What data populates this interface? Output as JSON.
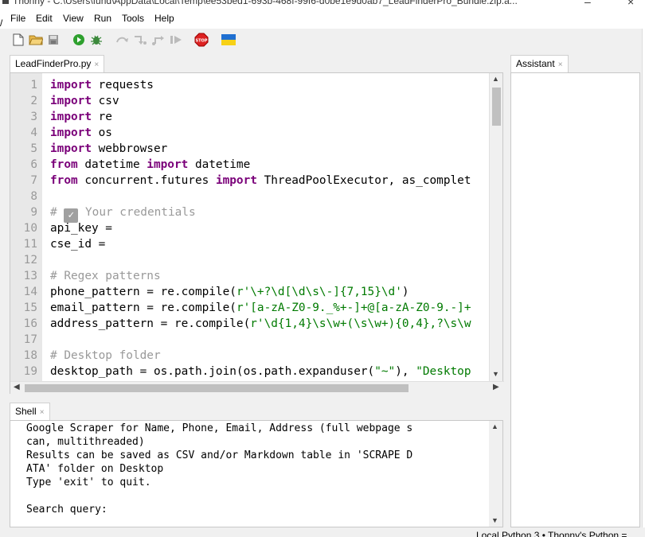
{
  "window": {
    "app_name": "Thonny",
    "title_path": "C:\\Users\\fund\\AppData\\Local\\Temp\\ee53bed1-693b-468f-99f6-d0be1e9d0ab7_LeadFinderPro_Bundle.zip.a..."
  },
  "menu": {
    "items": [
      {
        "label": "File"
      },
      {
        "label": "Edit"
      },
      {
        "label": "View"
      },
      {
        "label": "Run"
      },
      {
        "label": "Tools"
      },
      {
        "label": "Help"
      }
    ]
  },
  "toolbar": {
    "icons": [
      "new-file-icon",
      "open-folder-icon",
      "save-icon",
      "run-icon",
      "debug-bug-icon",
      "step-over-icon",
      "step-into-icon",
      "step-out-icon",
      "resume-icon",
      "stop-icon",
      "ukraine-flag-icon"
    ]
  },
  "editor": {
    "tab_label": "LeadFinderPro.py",
    "line_numbers": [
      "1",
      "2",
      "3",
      "4",
      "5",
      "6",
      "7",
      "8",
      "9",
      "10",
      "11",
      "12",
      "13",
      "14",
      "15",
      "16",
      "17",
      "18",
      "19"
    ]
  },
  "code": {
    "l1_kw": "import",
    "l1_rest": " requests",
    "l2_kw": "import",
    "l2_rest": " csv",
    "l3_kw": "import",
    "l3_rest": " re",
    "l4_kw": "import",
    "l4_rest": " os",
    "l5_kw": "import",
    "l5_rest": " webbrowser",
    "l6_kw1": "from",
    "l6_mid": " datetime ",
    "l6_kw2": "import",
    "l6_rest": " datetime",
    "l7_kw1": "from",
    "l7_mid": " concurrent.futures ",
    "l7_kw2": "import",
    "l7_rest": " ThreadPoolExecutor, as_complet",
    "l9_pre": "# ",
    "l9_check": "✓",
    "l9_post": " Your credentials",
    "l10": "api_key = ",
    "l11": "cse_id = ",
    "l13": "# Regex patterns",
    "l14_pre": "phone_pattern = re.compile(",
    "l14_str": "r'\\+?\\d[\\d\\s\\-]{7,15}\\d'",
    "l14_post": ")",
    "l15_pre": "email_pattern = re.compile(",
    "l15_str": "r'[a-zA-Z0-9._%+-]+@[a-zA-Z0-9.-]+",
    "l16_pre": "address_pattern = re.compile(",
    "l16_str": "r'\\d{1,4}\\s\\w+(\\s\\w+){0,4},?\\s\\w",
    "l18": "# Desktop folder",
    "l19_pre": "desktop_path = os.path.join(os.path.expanduser(",
    "l19_str1": "\"~\"",
    "l19_mid": "), ",
    "l19_str2": "\"Desktop"
  },
  "shell": {
    "tab_label": "Shell",
    "output": "Google Scraper for Name, Phone, Email, Address (full webpage s\ncan, multithreaded)\nResults can be saved as CSV and/or Markdown table in 'SCRAPE D\nATA' folder on Desktop\nType 'exit' to quit.\n\nSearch query:"
  },
  "assistant": {
    "tab_label": "Assistant"
  },
  "statusbar": {
    "interpreter": "Local Python 3  •  Thonny's Python  ="
  },
  "colors": {
    "keyword": "#7a0079",
    "comment": "#999999",
    "string": "#007a00",
    "gutter": "#e8e8e8"
  }
}
